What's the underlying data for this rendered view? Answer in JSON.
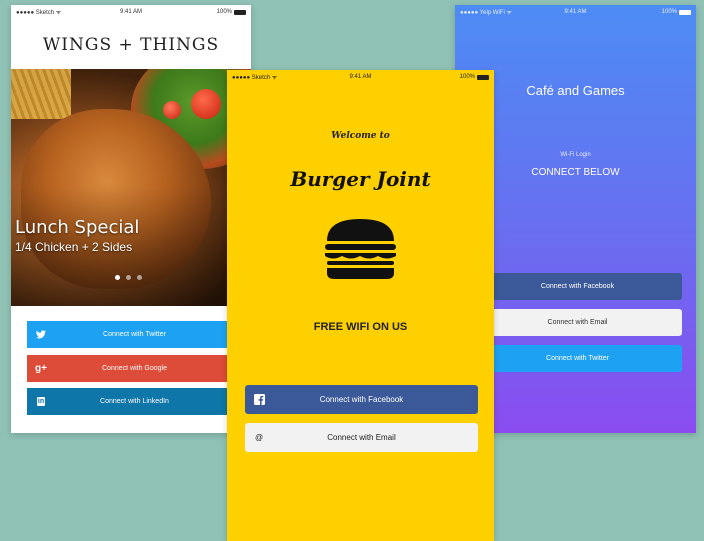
{
  "left_app": {
    "status": {
      "carrier": "●●●●● Sketch ᯤ",
      "time": "9:41 AM",
      "battery": "100%"
    },
    "title": "WINGS + THINGS",
    "hero": {
      "title": "Lunch Special",
      "subtitle": "1/4 Chicken + 2 Sides"
    },
    "buttons": [
      {
        "label": "Connect with Twitter",
        "icon": "twitter-icon",
        "color": "#1da1f2"
      },
      {
        "label": "Connect with Google",
        "icon": "google-plus-icon",
        "icon_text": "g+",
        "color": "#dd4b39"
      },
      {
        "label": "Connect with LinkedIn",
        "icon": "linkedin-icon",
        "icon_text": "in",
        "color": "#0e76a8"
      }
    ]
  },
  "middle_app": {
    "status": {
      "carrier": "●●●●● Sketch ᯤ",
      "time": "9:41 AM",
      "battery": "100%"
    },
    "welcome": "Welcome to",
    "brand": "Burger Joint",
    "tagline": "FREE WIFI ON US",
    "buttons": [
      {
        "label": "Connect with Facebook",
        "icon": "facebook-icon",
        "color": "#3b5998"
      },
      {
        "label": "Connect with Email",
        "icon": "at-icon",
        "icon_text": "@",
        "color": "#f2f2f2"
      }
    ]
  },
  "right_app": {
    "status": {
      "carrier": "●●●●● Yelp WiFi ᯤ",
      "time": "9:41 AM",
      "battery": "100%"
    },
    "title": "Café and Games",
    "wifi_login": "Wi-Fi Login",
    "connect_below": "CONNECT BELOW",
    "buttons": [
      {
        "label": "Connect with Facebook",
        "color": "#3b5998"
      },
      {
        "label": "Connect with Email",
        "color": "#f2f2f2"
      },
      {
        "label": "Connect with Twitter",
        "color": "#1da1f2"
      }
    ]
  }
}
